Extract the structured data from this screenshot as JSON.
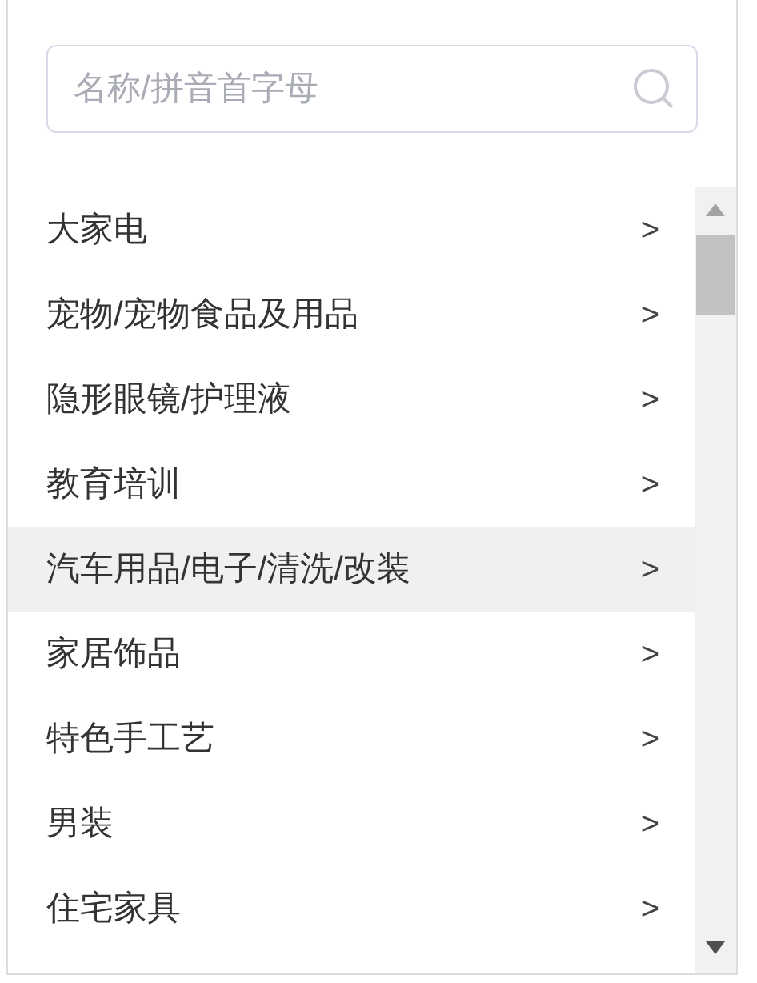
{
  "search": {
    "placeholder": "名称/拼音首字母"
  },
  "categories": [
    {
      "label": "大家电",
      "arrow": ">",
      "selected": false
    },
    {
      "label": "宠物/宠物食品及用品",
      "arrow": ">",
      "selected": false
    },
    {
      "label": "隐形眼镜/护理液",
      "arrow": ">",
      "selected": false
    },
    {
      "label": "教育培训",
      "arrow": ">",
      "selected": false
    },
    {
      "label": "汽车用品/电子/清洗/改装",
      "arrow": ">",
      "selected": true
    },
    {
      "label": "家居饰品",
      "arrow": ">",
      "selected": false
    },
    {
      "label": "特色手工艺",
      "arrow": ">",
      "selected": false
    },
    {
      "label": "男装",
      "arrow": ">",
      "selected": false
    },
    {
      "label": "住宅家具",
      "arrow": ">",
      "selected": false
    }
  ]
}
